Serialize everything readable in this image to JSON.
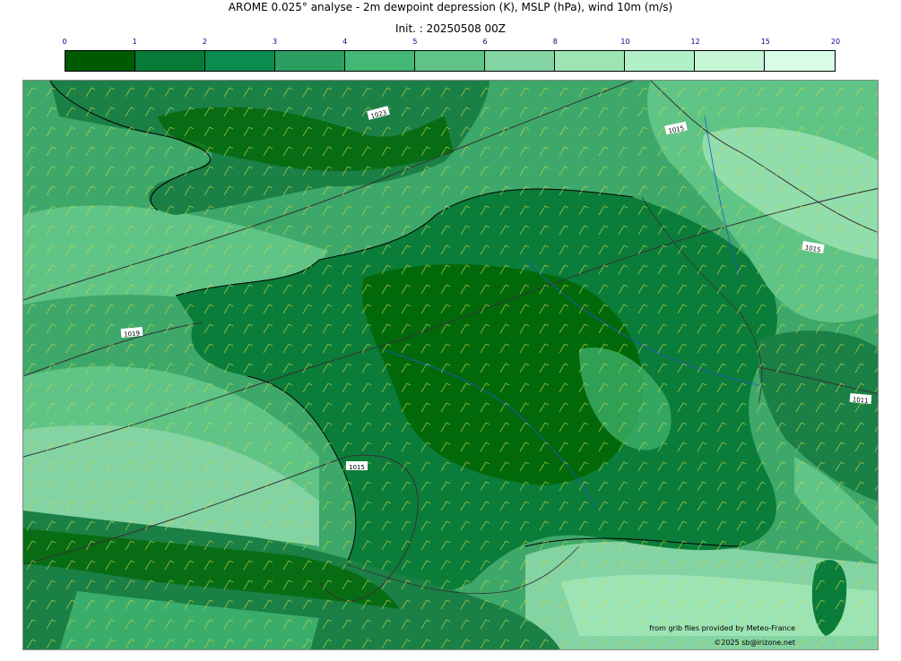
{
  "header": {
    "title": "AROME 0.025° analyse - 2m dewpoint depression (K), MSLP (hPa), wind 10m (m/s)",
    "init": "Init. : 20250508 00Z"
  },
  "colorbar": {
    "ticks": [
      "0",
      "1",
      "2",
      "3",
      "4",
      "5",
      "6",
      "8",
      "10",
      "12",
      "15",
      "20"
    ],
    "colors": [
      "#005a00",
      "#087a38",
      "#0a8c4e",
      "#2b9e61",
      "#44b874",
      "#5fc486",
      "#84d3a3",
      "#9de4b4",
      "#b0f0c6",
      "#c4f6d6",
      "#d8fde6"
    ]
  },
  "map": {
    "isobar_labels": [
      "1023",
      "1015",
      "1015",
      "1019",
      "1015",
      "1011"
    ]
  },
  "credits": {
    "source": "from grib files provided by Meteo-France",
    "copyright": "©2025 sb@irizone.net"
  }
}
